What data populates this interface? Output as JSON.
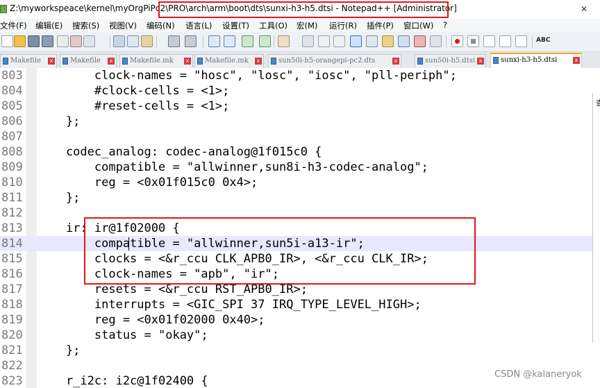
{
  "window": {
    "title": "Z:\\myworkspeace\\kernel\\myOrgPiPc2\\PRO\\arch\\arm\\boot\\dts\\sunxi-h3-h5.dtsi - Notepad++ [Administrator]",
    "close_glyph": "✕"
  },
  "menu": [
    "文件(F)",
    "编辑(E)",
    "搜索(S)",
    "视图(V)",
    "编码(N)",
    "语言(L)",
    "设置(T)",
    "工具(O)",
    "宏(M)",
    "运行(R)",
    "插件(P)",
    "窗口(W)",
    "?"
  ],
  "toolbar": {
    "buttons": [
      "new-file-icon",
      "open-file-icon",
      "save-icon",
      "save-all-icon",
      "close-icon",
      "close-all-icon",
      "print-icon",
      "cut-icon",
      "copy-icon",
      "paste-icon",
      "undo-icon",
      "redo-icon",
      "find-icon",
      "replace-icon",
      "zoom-in-icon",
      "zoom-out-icon",
      "sync-scroll-icon",
      "word-wrap-icon",
      "all-characters-icon",
      "indent-guide-icon",
      "udl-icon",
      "doc-map-icon",
      "function-list-icon",
      "folder-workspace-icon",
      "monitor-icon",
      "record-macro-icon",
      "stop-macro-icon",
      "play-macro-icon",
      "run-macro-multiple-icon",
      "save-macro-icon",
      "spell-check-icon"
    ],
    "spellcheck_label": "ABC"
  },
  "tabs": [
    {
      "label": "Makefile"
    },
    {
      "label": "Makefile"
    },
    {
      "label": "Makefile.mk"
    },
    {
      "label": "Makefile.mk"
    },
    {
      "label": "sun50i-h5-orangepi-pc2.dts"
    },
    {
      "label": "sun50i-h5.dtsi"
    },
    {
      "label": "sunxi-h3-h5.dtsi"
    }
  ],
  "editor": {
    "lines": [
      {
        "num": "803",
        "text": "        clock-names = \"hosc\", \"losc\", \"iosc\", \"pll-periph\";"
      },
      {
        "num": "804",
        "text": "        #clock-cells = <1>;"
      },
      {
        "num": "805",
        "text": "        #reset-cells = <1>;"
      },
      {
        "num": "806",
        "text": "    };"
      },
      {
        "num": "807",
        "text": ""
      },
      {
        "num": "808",
        "text": "    codec_analog: codec-analog@1f015c0 {"
      },
      {
        "num": "809",
        "text": "        compatible = \"allwinner,sun8i-h3-codec-analog\";"
      },
      {
        "num": "810",
        "text": "        reg = <0x01f015c0 0x4>;"
      },
      {
        "num": "811",
        "text": "    };"
      },
      {
        "num": "812",
        "text": ""
      },
      {
        "num": "813",
        "text": "    ir: ir@1f02000 {"
      },
      {
        "num": "814",
        "text": "        compatible = \"allwinner,sun5i-a13-ir\";"
      },
      {
        "num": "815",
        "text": "        clocks = <&r_ccu CLK_APB0_IR>, <&r_ccu CLK_IR>;"
      },
      {
        "num": "816",
        "text": "        clock-names = \"apb\", \"ir\";"
      },
      {
        "num": "817",
        "text": "        resets = <&r_ccu RST_APB0_IR>;"
      },
      {
        "num": "818",
        "text": "        interrupts = <GIC_SPI 37 IRQ_TYPE_LEVEL_HIGH>;"
      },
      {
        "num": "819",
        "text": "        reg = <0x01f02000 0x40>;"
      },
      {
        "num": "820",
        "text": "        status = \"okay\";"
      },
      {
        "num": "821",
        "text": "    };"
      },
      {
        "num": "822",
        "text": ""
      },
      {
        "num": "823",
        "text": "    r_i2c: i2c@1f02400 {"
      }
    ]
  },
  "side_panel": {
    "label": "查"
  },
  "watermark": "CSDN @kalaneryok",
  "colors": {
    "highlight_box": "#e3141a",
    "current_line": "#e8e8ff",
    "active_tab_accent": "#f5a623"
  }
}
